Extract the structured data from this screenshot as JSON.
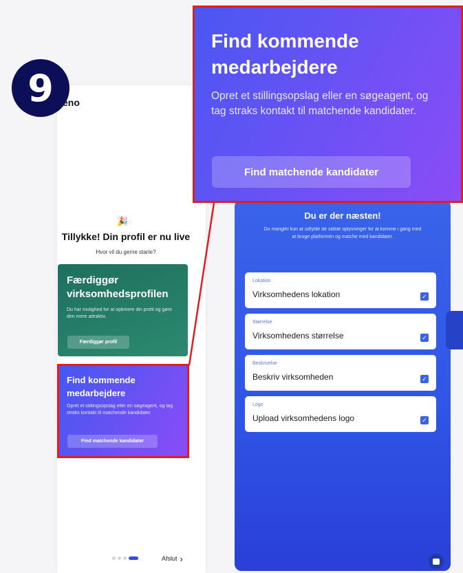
{
  "step_number": "9",
  "left": {
    "logo": "eno",
    "emoji": "🎉",
    "title": "Tillykke! Din profil er nu live",
    "subtitle": "Hvor vil du gerne starte?",
    "card_profile": {
      "title": "Færdiggør virksomhedsprofilen",
      "text": "Du har mulighed for at optimere din profil og gøre den mere attraktiv.",
      "button": "Færdiggør profil"
    },
    "card_find": {
      "title": "Find kommende medarbejdere",
      "text": "Opret et stillingsopslag eller en søgeagent, og tag straks kontakt til matchende kandidater.",
      "button": "Find matchende kandidater"
    },
    "exit": "Afslut",
    "exit_chevron": "›"
  },
  "right": {
    "title": "Du er der næsten!",
    "subtitle": "Du mangler kun at udfylde de sidste oplysninger for at komme i gang med at bruge platformen og matche med kandidater.",
    "fields": [
      {
        "label": "Lokation",
        "value": "Virksomhedens lokation"
      },
      {
        "label": "Størrelse",
        "value": "Virksomhedens størrelse"
      },
      {
        "label": "Beskrivelse",
        "value": "Beskriv virksomheden"
      },
      {
        "label": "Logo",
        "value": "Upload virksomhedens logo"
      }
    ],
    "check_glyph": "✓"
  },
  "zoom": {
    "title": "Find kommende medarbejdere",
    "text": "Opret et stillingsopslag eller en søgeagent, og tag straks kontakt til matchende kandidater.",
    "button": "Find matchende kandidater"
  },
  "colors": {
    "highlight": "#e11d22",
    "badge": "#0c0f57",
    "accent": "#3a49e6"
  }
}
